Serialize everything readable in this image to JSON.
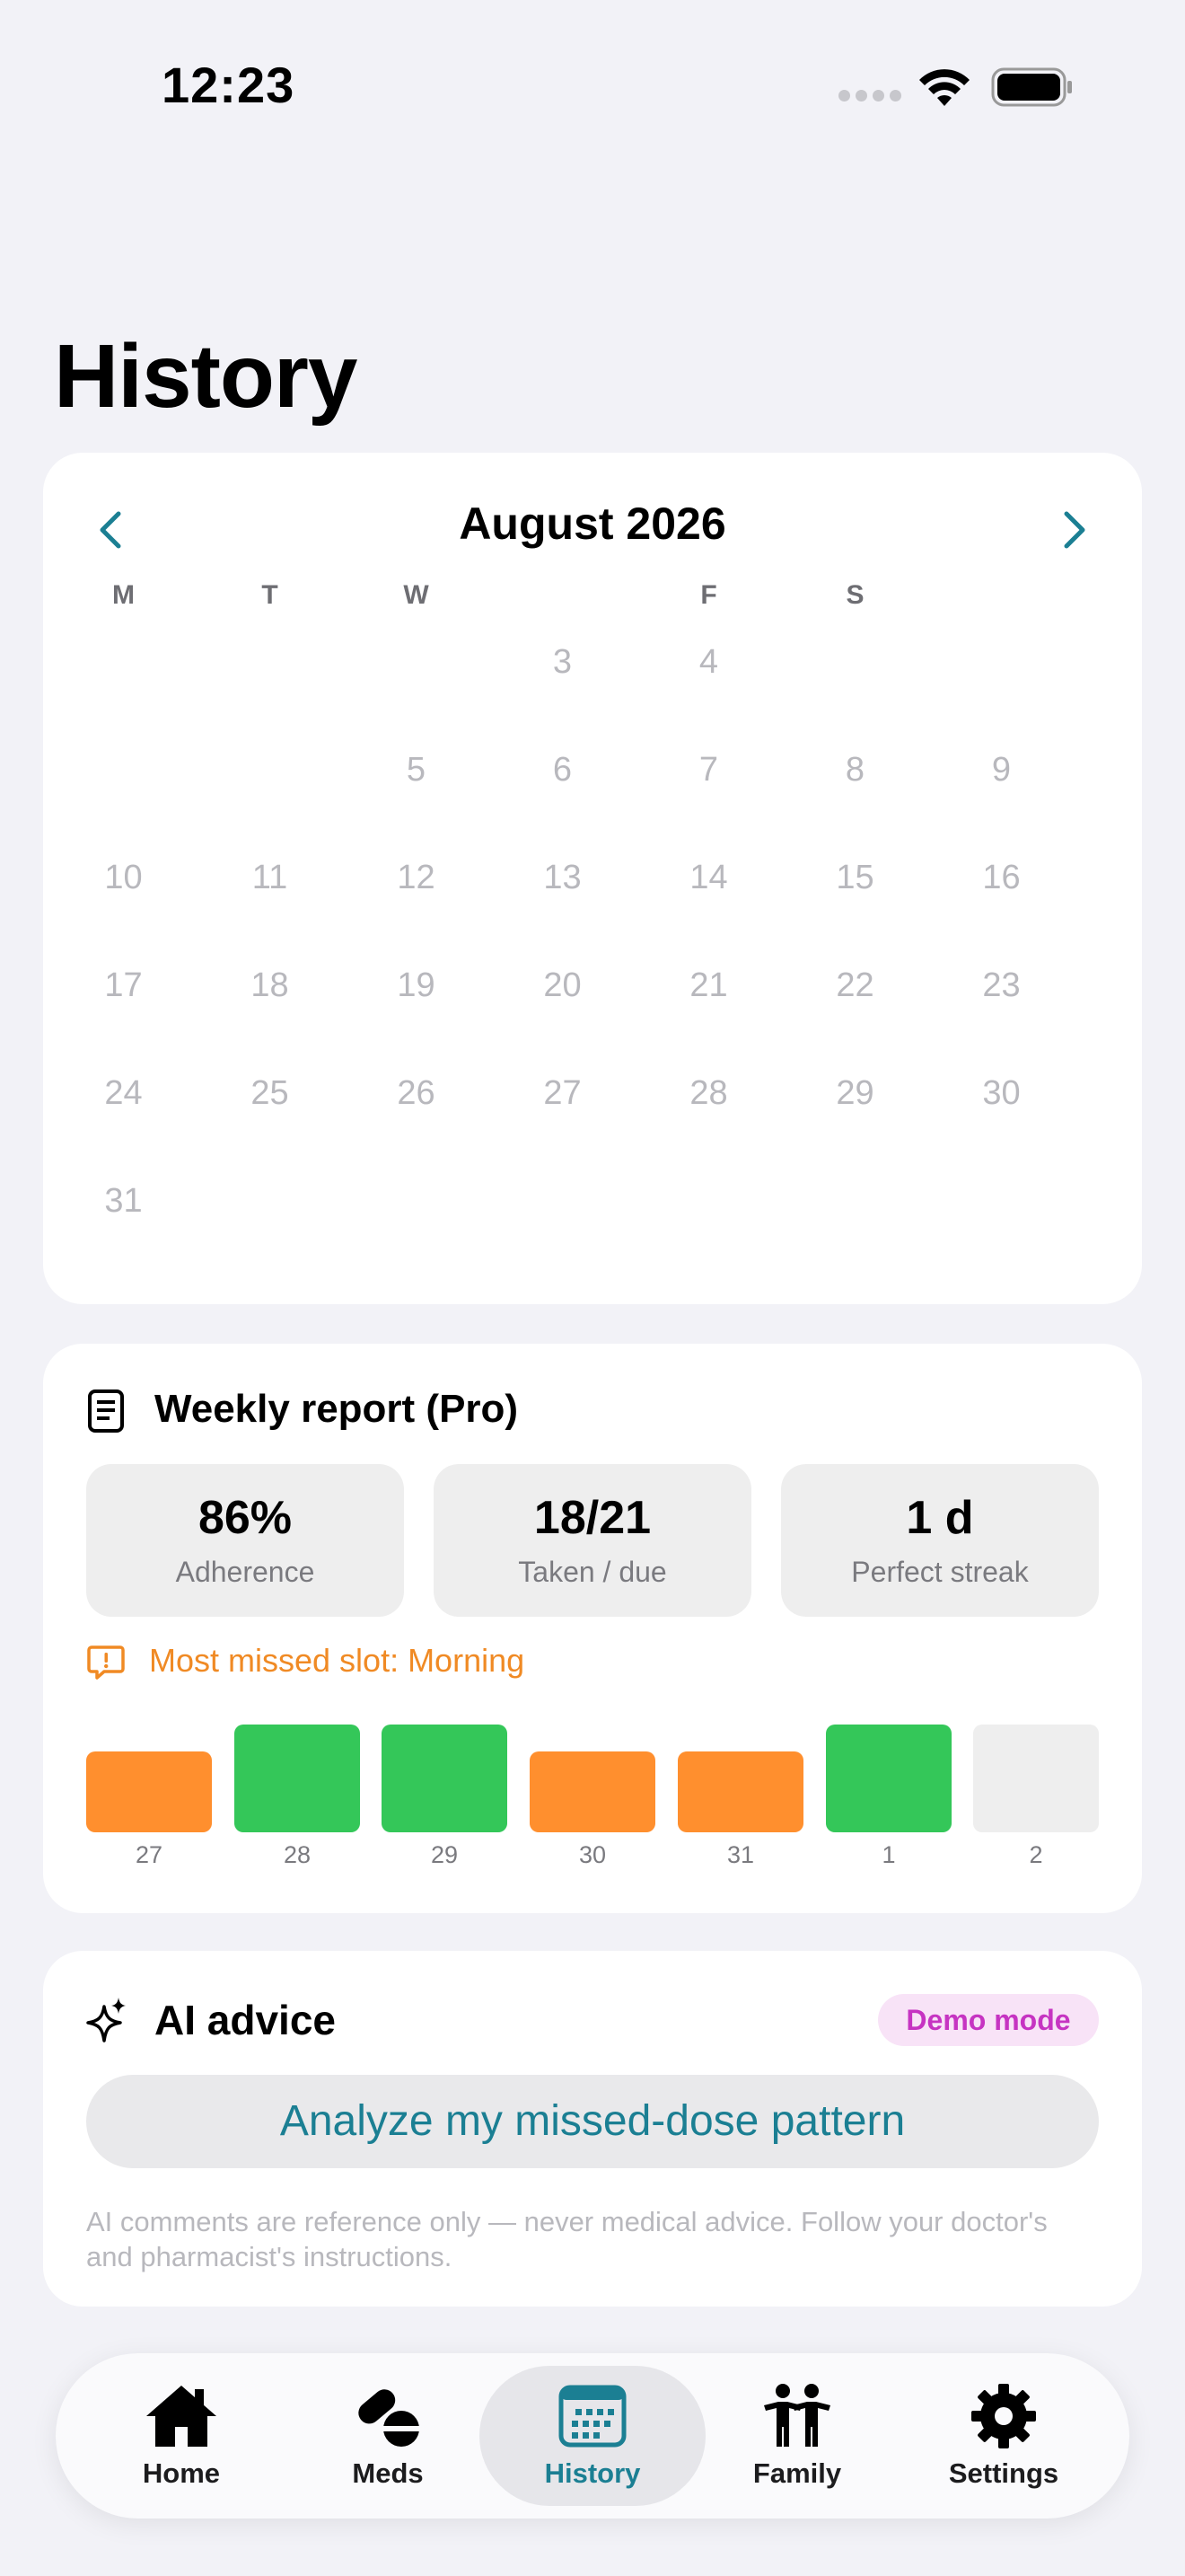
{
  "status_bar": {
    "time": "12:23"
  },
  "page_title": "History",
  "calendar": {
    "month_label": "August 2026",
    "weekdays": [
      "M",
      "T",
      "W",
      "",
      "F",
      "S",
      ""
    ],
    "days": [
      {
        "d": "3",
        "col": 3,
        "row": 0
      },
      {
        "d": "4",
        "col": 4,
        "row": 0
      },
      {
        "d": "5",
        "col": 2,
        "row": 1
      },
      {
        "d": "6",
        "col": 3,
        "row": 1
      },
      {
        "d": "7",
        "col": 4,
        "row": 1
      },
      {
        "d": "8",
        "col": 5,
        "row": 1
      },
      {
        "d": "9",
        "col": 6,
        "row": 1
      },
      {
        "d": "10",
        "col": 0,
        "row": 2
      },
      {
        "d": "11",
        "col": 1,
        "row": 2
      },
      {
        "d": "12",
        "col": 2,
        "row": 2
      },
      {
        "d": "13",
        "col": 3,
        "row": 2
      },
      {
        "d": "14",
        "col": 4,
        "row": 2
      },
      {
        "d": "15",
        "col": 5,
        "row": 2
      },
      {
        "d": "16",
        "col": 6,
        "row": 2
      },
      {
        "d": "17",
        "col": 0,
        "row": 3
      },
      {
        "d": "18",
        "col": 1,
        "row": 3
      },
      {
        "d": "19",
        "col": 2,
        "row": 3
      },
      {
        "d": "20",
        "col": 3,
        "row": 3
      },
      {
        "d": "21",
        "col": 4,
        "row": 3
      },
      {
        "d": "22",
        "col": 5,
        "row": 3
      },
      {
        "d": "23",
        "col": 6,
        "row": 3
      },
      {
        "d": "24",
        "col": 0,
        "row": 4
      },
      {
        "d": "25",
        "col": 1,
        "row": 4
      },
      {
        "d": "26",
        "col": 2,
        "row": 4
      },
      {
        "d": "27",
        "col": 3,
        "row": 4
      },
      {
        "d": "28",
        "col": 4,
        "row": 4
      },
      {
        "d": "29",
        "col": 5,
        "row": 4
      },
      {
        "d": "30",
        "col": 6,
        "row": 4
      },
      {
        "d": "31",
        "col": 0,
        "row": 5
      }
    ]
  },
  "weekly_report": {
    "title": "Weekly report (Pro)",
    "stats": [
      {
        "value": "86%",
        "label": "Adherence"
      },
      {
        "value": "18/21",
        "label": "Taken / due"
      },
      {
        "value": "1 d",
        "label": "Perfect streak"
      }
    ],
    "most_missed": "Most missed slot: Morning",
    "days": [
      {
        "label": "27",
        "status": "partial"
      },
      {
        "label": "28",
        "status": "full"
      },
      {
        "label": "29",
        "status": "full"
      },
      {
        "label": "30",
        "status": "partial"
      },
      {
        "label": "31",
        "status": "partial"
      },
      {
        "label": "1",
        "status": "full"
      },
      {
        "label": "2",
        "status": "none"
      }
    ],
    "colors": {
      "full": "#34c759",
      "partial": "#ff8f2e",
      "none": "#eeeeee",
      "warning": "#f08a24"
    }
  },
  "ai_advice": {
    "title": "AI advice",
    "badge": "Demo mode",
    "button": "Analyze my missed-dose pattern",
    "disclaimer": "AI comments are reference only — never medical advice. Follow your doctor's and pharmacist's instructions."
  },
  "tab_bar": {
    "tabs": [
      {
        "label": "Home",
        "icon": "house-icon",
        "active": false
      },
      {
        "label": "Meds",
        "icon": "pills-icon",
        "active": false
      },
      {
        "label": "History",
        "icon": "calendar-icon",
        "active": true
      },
      {
        "label": "Family",
        "icon": "people-icon",
        "active": false
      },
      {
        "label": "Settings",
        "icon": "gear-icon",
        "active": false
      }
    ],
    "accent": "#1b7f93"
  }
}
